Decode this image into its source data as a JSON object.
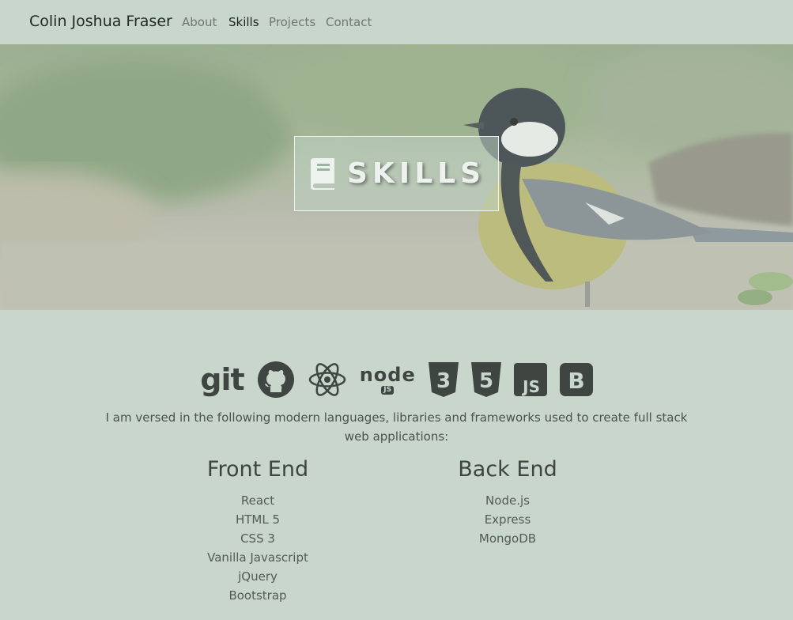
{
  "navbar": {
    "brand": "Colin Joshua Fraser",
    "links": [
      {
        "label": "About",
        "active": false
      },
      {
        "label": "Skills",
        "active": true
      },
      {
        "label": "Projects",
        "active": false
      },
      {
        "label": "Contact",
        "active": false
      }
    ]
  },
  "hero": {
    "title": "SKILLS",
    "icon": "book-icon"
  },
  "skills_icons": [
    {
      "name": "git-icon",
      "label": "git"
    },
    {
      "name": "github-icon"
    },
    {
      "name": "react-icon"
    },
    {
      "name": "nodejs-icon",
      "label": "node",
      "sublabel": "JS"
    },
    {
      "name": "css3-icon",
      "label": "3"
    },
    {
      "name": "html5-icon",
      "label": "5"
    },
    {
      "name": "javascript-icon",
      "label": "JS"
    },
    {
      "name": "bootstrap-icon",
      "label": "B"
    }
  ],
  "intro": "I am versed in the following modern languages, libraries and frameworks used to create full stack web applications:",
  "front_end": {
    "title": "Front End",
    "items": [
      "React",
      "HTML 5",
      "CSS 3",
      "Vanilla Javascript",
      "jQuery",
      "Bootstrap"
    ]
  },
  "back_end": {
    "title": "Back End",
    "items": [
      "Node.js",
      "Express",
      "MongoDB"
    ]
  },
  "colors": {
    "background": "#c9d6cb",
    "icon": "#3f4642",
    "heading": "#3e4541"
  }
}
